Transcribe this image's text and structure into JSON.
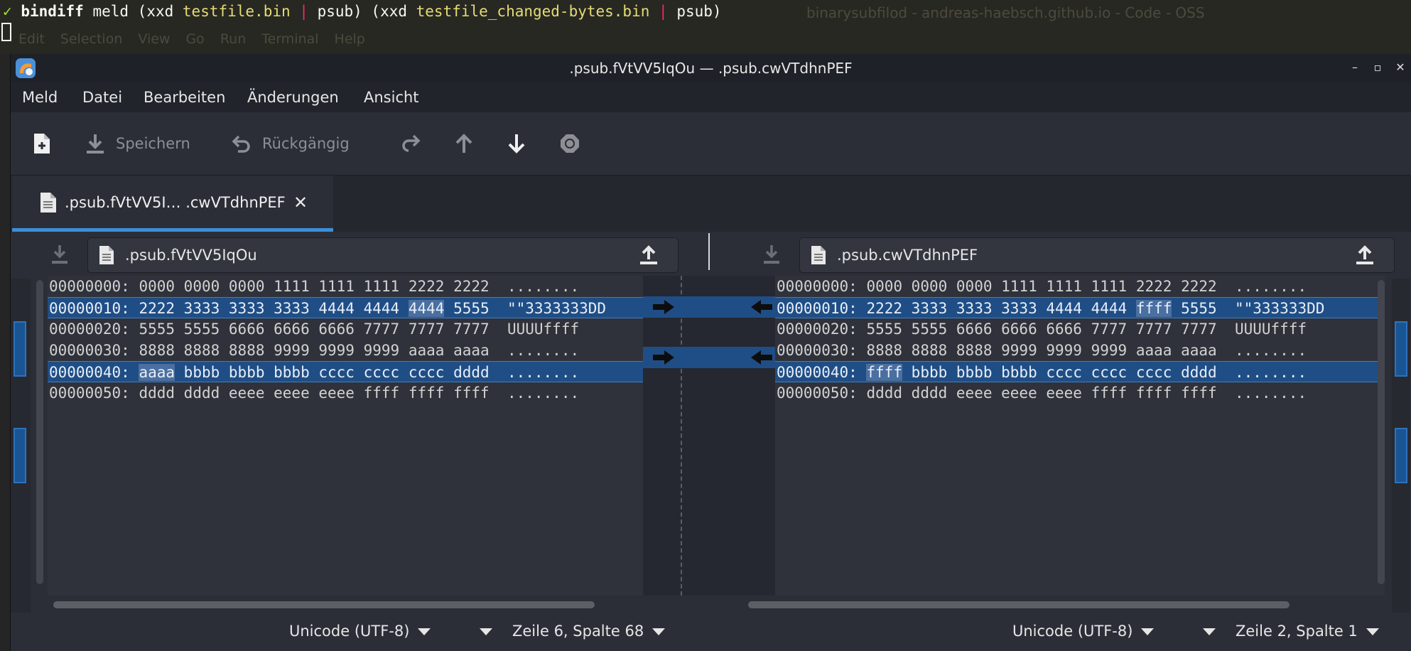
{
  "terminal": {
    "prompt_mark": "✓",
    "command": "bindiff",
    "args_1": " meld (xxd ",
    "file_1": "testfile.bin",
    "pipe_1": " | ",
    "psub_1": "psub) (xxd ",
    "file_2": "testfile_changed-bytes.bin",
    "pipe_2": " | ",
    "psub_2": "psub)",
    "ghost_title": "binarysubfilod - andreas-haebsch.github.io - Code - OSS",
    "bg_menu": [
      "Edit",
      "Selection",
      "View",
      "Go",
      "Run",
      "Terminal",
      "Help"
    ]
  },
  "window": {
    "title": ".psub.fVtVV5IqOu — .psub.cwVTdhnPEF",
    "minimize": "–",
    "maximize": "▫",
    "close": "✕"
  },
  "menu": [
    "Meld",
    "Datei",
    "Bearbeiten",
    "Änderungen",
    "Ansicht"
  ],
  "toolbar": {
    "save_label": "Speichern",
    "undo_label": "Rückgängig"
  },
  "tab": {
    "label": ".psub.fVtVV5I… .cwVTdhnPEF",
    "close": "✕"
  },
  "left_file": {
    "name": ".psub.fVtVV5IqOu"
  },
  "right_file": {
    "name": ".psub.cwVTdhnPEF"
  },
  "left_lines": [
    {
      "addr": "00000000:",
      "hex": [
        "0000",
        "0000",
        "0000",
        "1111",
        "1111",
        "1111",
        "2222",
        "2222"
      ],
      "ascii": "........",
      "changed": false,
      "hl": -1
    },
    {
      "addr": "00000010:",
      "hex": [
        "2222",
        "3333",
        "3333",
        "3333",
        "4444",
        "4444",
        "4444",
        "5555"
      ],
      "ascii": "\"\"3333333DD",
      "changed": true,
      "hl": 6
    },
    {
      "addr": "00000020:",
      "hex": [
        "5555",
        "5555",
        "6666",
        "6666",
        "6666",
        "7777",
        "7777",
        "7777"
      ],
      "ascii": "UUUUffff",
      "changed": false,
      "hl": -1
    },
    {
      "addr": "00000030:",
      "hex": [
        "8888",
        "8888",
        "8888",
        "9999",
        "9999",
        "9999",
        "aaaa",
        "aaaa"
      ],
      "ascii": "........",
      "changed": false,
      "hl": -1
    },
    {
      "addr": "00000040:",
      "hex": [
        "aaaa",
        "bbbb",
        "bbbb",
        "bbbb",
        "cccc",
        "cccc",
        "cccc",
        "dddd"
      ],
      "ascii": "........",
      "changed": true,
      "hl": 0
    },
    {
      "addr": "00000050:",
      "hex": [
        "dddd",
        "dddd",
        "eeee",
        "eeee",
        "eeee",
        "ffff",
        "ffff",
        "ffff"
      ],
      "ascii": "........",
      "changed": false,
      "hl": -1
    }
  ],
  "right_lines": [
    {
      "addr": "00000000:",
      "hex": [
        "0000",
        "0000",
        "0000",
        "1111",
        "1111",
        "1111",
        "2222",
        "2222"
      ],
      "ascii": "........",
      "changed": false,
      "hl": -1
    },
    {
      "addr": "00000010:",
      "hex": [
        "2222",
        "3333",
        "3333",
        "3333",
        "4444",
        "4444",
        "ffff",
        "5555"
      ],
      "ascii": "\"\"333333DD",
      "changed": true,
      "hl": 6
    },
    {
      "addr": "00000020:",
      "hex": [
        "5555",
        "5555",
        "6666",
        "6666",
        "6666",
        "7777",
        "7777",
        "7777"
      ],
      "ascii": "UUUUffff",
      "changed": false,
      "hl": -1
    },
    {
      "addr": "00000030:",
      "hex": [
        "8888",
        "8888",
        "8888",
        "9999",
        "9999",
        "9999",
        "aaaa",
        "aaaa"
      ],
      "ascii": "........",
      "changed": false,
      "hl": -1
    },
    {
      "addr": "00000040:",
      "hex": [
        "ffff",
        "bbbb",
        "bbbb",
        "bbbb",
        "cccc",
        "cccc",
        "cccc",
        "dddd"
      ],
      "ascii": "........",
      "changed": true,
      "hl": 0
    },
    {
      "addr": "00000050:",
      "hex": [
        "dddd",
        "dddd",
        "eeee",
        "eeee",
        "eeee",
        "ffff",
        "ffff",
        "ffff"
      ],
      "ascii": "........",
      "changed": false,
      "hl": -1
    }
  ],
  "status": {
    "left_encoding": "Unicode (UTF-8)",
    "left_position": "Zeile 6, Spalte 68",
    "right_encoding": "Unicode (UTF-8)",
    "right_position": "Zeile 2, Spalte 1"
  },
  "colors": {
    "change_bg": "#1f4e86",
    "accent": "#3d8fd9",
    "terminal_string": "#e6db74",
    "terminal_pipe": "#f92672"
  }
}
